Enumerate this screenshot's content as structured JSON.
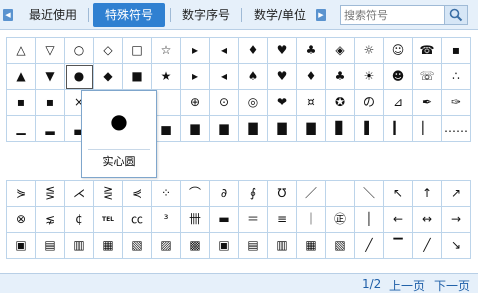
{
  "tabs": [
    {
      "label": "最近使用",
      "active": false
    },
    {
      "label": "特殊符号",
      "active": true
    },
    {
      "label": "数字序号",
      "active": false
    },
    {
      "label": "数学/单位",
      "active": false
    }
  ],
  "search": {
    "placeholder": "搜索符号"
  },
  "grid_top_rows": [
    [
      "△",
      "▽",
      "○",
      "◇",
      "□",
      "☆",
      "▸",
      "◂",
      "♦",
      "♥",
      "♣",
      "◈",
      "☼",
      "☺",
      "☎",
      "▪"
    ],
    [
      "▲",
      "▼",
      "●",
      "◆",
      "■",
      "★",
      "▸",
      "◂",
      "♠",
      "♥",
      "♦",
      "♣",
      "☀",
      "☻",
      "☏",
      "∴"
    ],
    [
      "▪",
      "▪",
      "×",
      "",
      "",
      "",
      "⊕",
      "⊙",
      "◎",
      "❤",
      "¤",
      "✪",
      "の",
      "⊿",
      "✒",
      "✑"
    ],
    [
      "▁",
      "▂",
      "▃",
      "",
      "",
      "▅",
      "▆",
      "▆",
      "▇",
      "▇",
      "▇",
      "▊",
      "▌",
      "▎",
      "▏",
      "……"
    ]
  ],
  "grid_bottom_rows": [
    [
      "⋟",
      "⋚",
      "⋌",
      "⋛",
      "⋞",
      "⁘",
      "⌒",
      "∂",
      "∮",
      "℧",
      "／",
      "",
      "＼",
      "↖",
      "↑",
      "↗"
    ],
    [
      "⊗",
      "⋦",
      "¢",
      "TEL",
      "㏄",
      "³",
      "卌",
      "▬",
      "＝",
      "≡",
      "｜",
      "㊣",
      "│",
      "←",
      "↔",
      "→"
    ],
    [
      "▣",
      "▤",
      "▥",
      "▦",
      "▧",
      "▨",
      "▩",
      "▣",
      "▤",
      "▥",
      "▦",
      "▧",
      "╱",
      "▔",
      "╱",
      "↘"
    ]
  ],
  "popup": {
    "symbol": "●",
    "name": "实心圆"
  },
  "footer": {
    "page": "1/2",
    "prev": "上一页",
    "next": "下一页"
  }
}
